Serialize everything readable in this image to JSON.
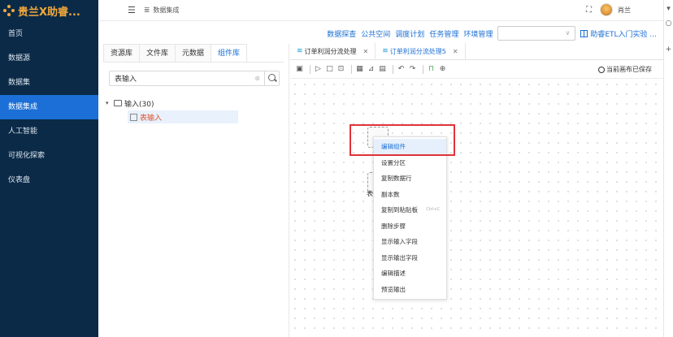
{
  "app": {
    "logo_text": "贵兰X助睿..."
  },
  "sidebar": {
    "items": [
      {
        "label": "首页"
      },
      {
        "label": "数据源"
      },
      {
        "label": "数据集"
      },
      {
        "label": "数据集成",
        "active": true
      },
      {
        "label": "人工智能"
      },
      {
        "label": "可视化探索"
      },
      {
        "label": "仪表盘"
      }
    ]
  },
  "header": {
    "breadcrumb": "数据集成",
    "username": "肖兰"
  },
  "modules": {
    "links": [
      "数据探查",
      "公共空间",
      "调度计划",
      "任务管理",
      "环境管理"
    ],
    "select_value": "",
    "help_link": "助睿ETL入门实验 ..."
  },
  "resource_panel": {
    "tabs": [
      "资源库",
      "文件库",
      "元数据",
      "组件库"
    ],
    "active_tab": "组件库",
    "search_value": "表输入",
    "tree": {
      "group": "输入(30)",
      "leaf": "表输入"
    }
  },
  "editor": {
    "tabs": [
      {
        "label": "订单利润分流处理"
      },
      {
        "label": "订单利润分流处理5",
        "active": true
      }
    ],
    "saved_status": "当前画布已保存",
    "node_label_fragment": "表"
  },
  "context_menu": {
    "items": [
      {
        "label": "编辑组件"
      },
      {
        "label": "设置分区"
      },
      {
        "label": "复制数据行"
      },
      {
        "label": "副本数"
      },
      {
        "label": "复制到粘贴板",
        "shortcut": "Ctrl+C"
      },
      {
        "label": "删除步骤"
      },
      {
        "label": "显示输入字段"
      },
      {
        "label": "显示输出字段"
      },
      {
        "label": "编辑描述"
      },
      {
        "label": "预览输出"
      }
    ]
  },
  "colors": {
    "sidebar_bg": "#0b2a47",
    "accent": "#1b6fd6",
    "logo": "#f2a93b",
    "highlight": "#e0323a"
  }
}
